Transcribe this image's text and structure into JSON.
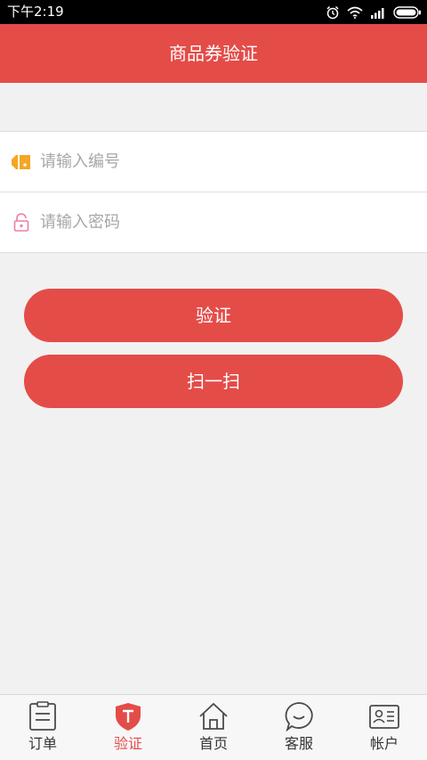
{
  "status_bar": {
    "time": "下午2:19",
    "icons": [
      "alarm-icon",
      "wifi-icon",
      "signal-icon",
      "battery-icon"
    ]
  },
  "header": {
    "title": "商品券验证"
  },
  "form": {
    "code_field": {
      "placeholder": "请输入编号",
      "value": "",
      "icon": "ticket-icon",
      "icon_color": "#f5a623"
    },
    "password_field": {
      "placeholder": "请输入密码",
      "value": "",
      "icon": "lock-icon",
      "icon_color": "#f07b9f"
    }
  },
  "buttons": {
    "verify_label": "验证",
    "scan_label": "扫一扫"
  },
  "tab_bar": {
    "tabs": [
      {
        "label": "订单",
        "icon": "order-icon",
        "active": false
      },
      {
        "label": "验证",
        "icon": "shield-icon",
        "active": true
      },
      {
        "label": "首页",
        "icon": "home-icon",
        "active": false
      },
      {
        "label": "客服",
        "icon": "chat-icon",
        "active": false
      },
      {
        "label": "帐户",
        "icon": "id-card-icon",
        "active": false
      }
    ]
  },
  "colors": {
    "accent": "#e44c48",
    "background": "#f1f1f1",
    "inactive_text": "#333333"
  }
}
